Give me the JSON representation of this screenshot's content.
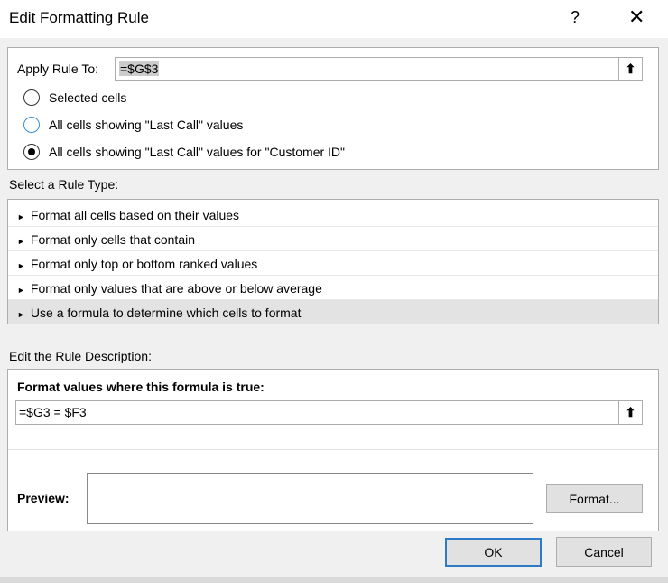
{
  "dialog": {
    "title": "Edit Formatting Rule",
    "help": "?",
    "close": "✕"
  },
  "apply": {
    "label": "Apply Rule To:",
    "value": "=$G$3",
    "upload_icon": "⬆"
  },
  "radios": [
    {
      "label": "Selected cells",
      "checked": false
    },
    {
      "label": "All cells showing \"Last Call\" values",
      "checked": false
    },
    {
      "label": "All cells showing \"Last Call\" values for \"Customer ID\"",
      "checked": true
    }
  ],
  "rule_type": {
    "label": "Select a Rule Type:",
    "items": [
      "Format all cells based on their values",
      "Format only cells that contain",
      "Format only top or bottom ranked values",
      "Format only values that are above or below average",
      "Use a formula to determine which cells to format"
    ],
    "selected": 4,
    "bullet": "►"
  },
  "description": {
    "label": "Edit the Rule Description:",
    "formula_label": "Format values where this formula is true:",
    "formula": "=$G3 = $F3",
    "preview_label": "Preview:",
    "format_button": "Format..."
  },
  "buttons": {
    "ok": "OK",
    "cancel": "Cancel"
  }
}
